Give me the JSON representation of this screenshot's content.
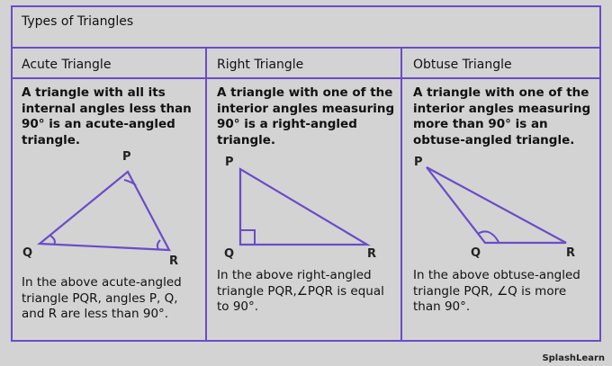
{
  "table": {
    "title": "Types of Triangles",
    "columns": [
      {
        "heading": "Acute Triangle",
        "description": "A triangle with all its internal angles less than 90° is an acute-angled triangle.",
        "note": "In the above acute-angled triangle PQR, angles P, Q, and R are less than 90°.",
        "vertices": {
          "p": "P",
          "q": "Q",
          "r": "R"
        }
      },
      {
        "heading": "Right Triangle",
        "description": "A triangle with one of the interior angles measuring 90° is a right-angled triangle.",
        "note": "In the above right-angled triangle PQR,∠PQR is equal to 90°.",
        "vertices": {
          "p": "P",
          "q": "Q",
          "r": "R"
        }
      },
      {
        "heading": "Obtuse Triangle",
        "description": "A triangle with one of the interior angles measuring more than 90° is an obtuse-angled triangle.",
        "note": "In the above obtuse-angled triangle PQR, ∠Q is more than 90°.",
        "vertices": {
          "p": "P",
          "q": "Q",
          "r": "R"
        }
      }
    ]
  },
  "branding": {
    "logo_text": "SplashLearn"
  },
  "colors": {
    "border": "#6a4cc8",
    "triangle_stroke": "#6a4cc8",
    "background": "#d3d3d3"
  }
}
